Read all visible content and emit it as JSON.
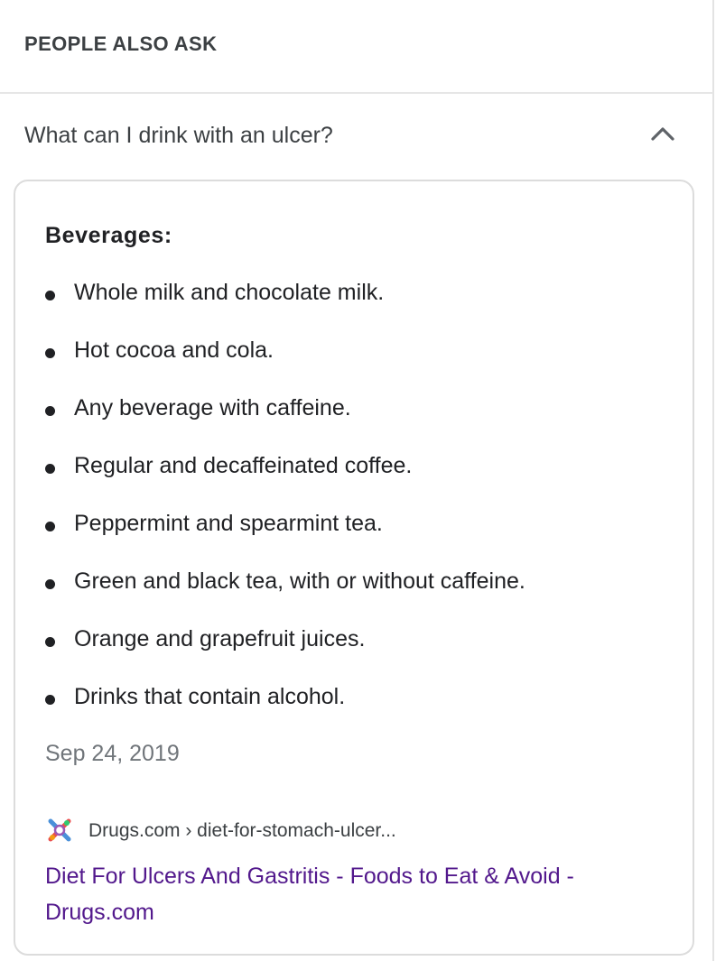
{
  "paa": {
    "header": "PEOPLE ALSO ASK",
    "question": "What can I drink with an ulcer?",
    "expand_icon": "chevron-up-icon",
    "answer": {
      "heading": "Beverages:",
      "items": [
        "Whole milk and chocolate milk.",
        "Hot cocoa and cola.",
        "Any beverage with caffeine.",
        "Regular and decaffeinated coffee.",
        "Peppermint and spearmint tea.",
        "Green and black tea, with or without caffeine.",
        "Orange and grapefruit juices.",
        "Drinks that contain alcohol."
      ],
      "date": "Sep 24, 2019"
    },
    "source": {
      "favicon": "drugs-com-favicon-icon",
      "breadcrumb": "Drugs.com › diet-for-stomach-ulcer...",
      "link_text": "Diet For Ulcers And Gastritis - Foods to Eat & Avoid - Drugs.com"
    }
  },
  "colors": {
    "text": "#202124",
    "muted": "#70757a",
    "visited_link": "#52188c",
    "border": "#dcdcdc"
  }
}
